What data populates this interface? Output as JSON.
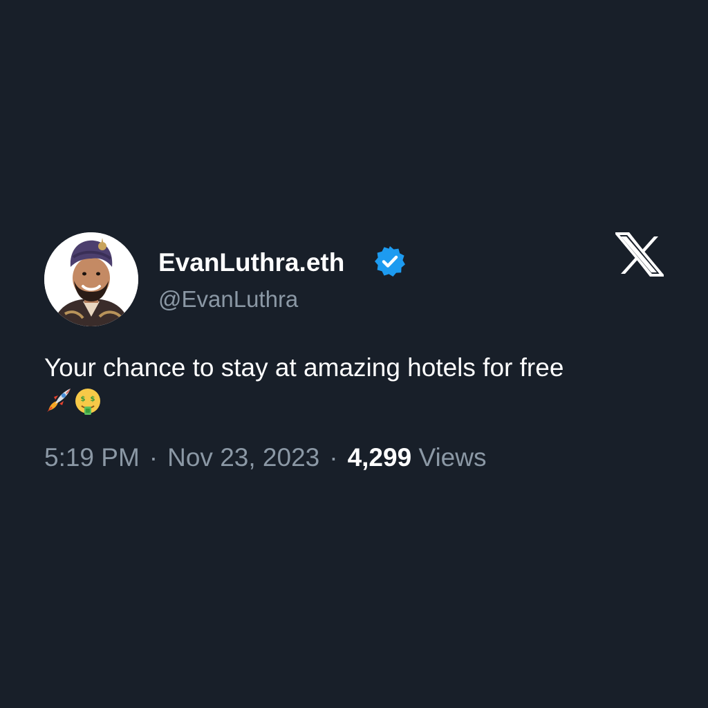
{
  "author": {
    "display_name": "EvanLuthra.eth",
    "handle": "@EvanLuthra",
    "verified": true
  },
  "tweet": {
    "text": "Your chance to stay at amazing hotels for free",
    "emojis": [
      "rocket-emoji",
      "money-mouth-face-emoji"
    ]
  },
  "meta": {
    "time": "5:19 PM",
    "separator": "·",
    "date": "Nov 23, 2023",
    "views_count": "4,299",
    "views_label": "Views"
  },
  "platform_logo": "x-logo-icon",
  "colors": {
    "background": "#181f29",
    "text_primary": "#ffffff",
    "text_secondary": "#8b98a5",
    "verified_badge": "#1d9bf0"
  }
}
